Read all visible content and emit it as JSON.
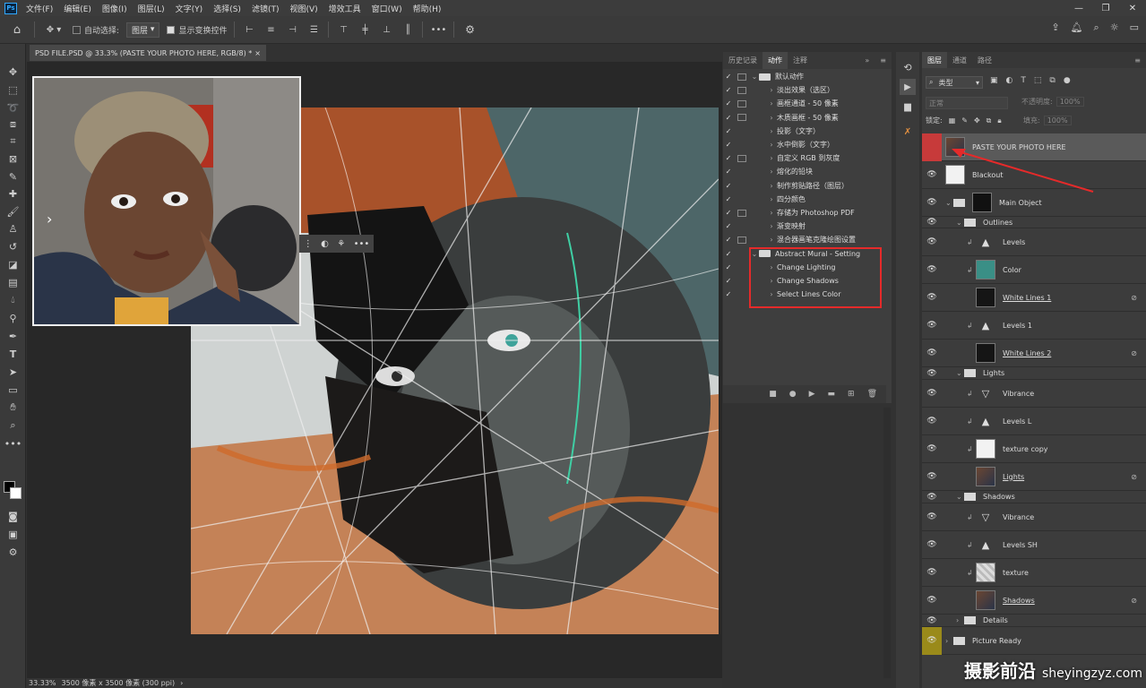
{
  "menu": {
    "logo": "Ps",
    "items": [
      "文件(F)",
      "编辑(E)",
      "图像(I)",
      "图层(L)",
      "文字(Y)",
      "选择(S)",
      "滤镜(T)",
      "视图(V)",
      "增效工具",
      "窗口(W)",
      "帮助(H)"
    ]
  },
  "options": {
    "auto_select_label": "自动选择:",
    "auto_select_value": "图层",
    "show_transform_label": "显示变换控件"
  },
  "document": {
    "tab_title": "PSD FILE.PSD @ 33.3% (PASTE YOUR PHOTO HERE, RGB/8) *",
    "zoom": "33.33%",
    "size_info": "3500 像素 x 3500 像素 (300 ppi)"
  },
  "actions_panel": {
    "tabs": [
      "历史记录",
      "动作",
      "注释"
    ],
    "active_tab": "动作",
    "rows": [
      {
        "label": "默认动作",
        "type": "set",
        "expanded": true,
        "dialog": true
      },
      {
        "label": "淡出效果（选区）",
        "dialog": true
      },
      {
        "label": "画框通道 - 50 像素",
        "dialog": true
      },
      {
        "label": "木质画框 - 50 像素",
        "dialog": true
      },
      {
        "label": "投影（文字）",
        "dialog": false
      },
      {
        "label": "水中倒影（文字）",
        "dialog": false
      },
      {
        "label": "自定义 RGB 到灰度",
        "dialog": true
      },
      {
        "label": "熔化的铅块",
        "dialog": false
      },
      {
        "label": "制作剪贴路径（图层）",
        "dialog": false
      },
      {
        "label": "四分颜色",
        "dialog": false
      },
      {
        "label": "存储为 Photoshop PDF",
        "dialog": true
      },
      {
        "label": "渐变映射",
        "dialog": false
      },
      {
        "label": "混合器画笔克隆绘图设置",
        "dialog": true
      },
      {
        "label": "Abstract Mural - Setting",
        "type": "set",
        "expanded": true,
        "dialog": false
      },
      {
        "label": "Change Lighting",
        "dialog": false
      },
      {
        "label": "Change Shadows",
        "dialog": false
      },
      {
        "label": "Select Lines Color",
        "dialog": false
      }
    ]
  },
  "layers_panel": {
    "tabs": [
      "图层",
      "通道",
      "路径"
    ],
    "active_tab": "图层",
    "filter_kind": "类型",
    "blend_mode": "正常",
    "opacity_label": "不透明度:",
    "opacity_value": "100%",
    "lock_label": "锁定:",
    "fill_label": "填充:",
    "fill_value": "100%",
    "layers": [
      {
        "name": "PASTE YOUR PHOTO HERE",
        "kind": "photo",
        "indent": 0,
        "selected": true
      },
      {
        "name": "Blackout",
        "kind": "white",
        "indent": 0
      },
      {
        "name": "Main Object",
        "kind": "group-mask",
        "indent": 0
      },
      {
        "name": "Outlines",
        "kind": "group",
        "indent": 1
      },
      {
        "name": "Levels",
        "kind": "levels",
        "indent": 2
      },
      {
        "name": "Color",
        "kind": "teal",
        "indent": 2
      },
      {
        "name": "White Lines 1",
        "kind": "dark",
        "indent": 2,
        "link": true
      },
      {
        "name": "Levels 1",
        "kind": "levels",
        "indent": 2
      },
      {
        "name": "White Lines 2",
        "kind": "dark",
        "indent": 2,
        "link": true
      },
      {
        "name": "Lights",
        "kind": "group",
        "indent": 1
      },
      {
        "name": "Vibrance",
        "kind": "vibrance",
        "indent": 2
      },
      {
        "name": "Levels L",
        "kind": "levels",
        "indent": 2
      },
      {
        "name": "texture copy",
        "kind": "white",
        "indent": 2
      },
      {
        "name": "Lights",
        "kind": "photo",
        "indent": 2,
        "link": true
      },
      {
        "name": "Shadows",
        "kind": "group",
        "indent": 1
      },
      {
        "name": "Vibrance",
        "kind": "vibrance",
        "indent": 2
      },
      {
        "name": "Levels SH",
        "kind": "levels",
        "indent": 2
      },
      {
        "name": "texture",
        "kind": "texture",
        "indent": 2
      },
      {
        "name": "Shadows",
        "kind": "photo",
        "indent": 2,
        "link": true
      },
      {
        "name": "Details",
        "kind": "group",
        "indent": 1
      },
      {
        "name": "Picture Ready",
        "kind": "group",
        "indent": 0
      }
    ]
  },
  "watermark": {
    "text": "摄影前沿",
    "url": "sheyingzyz.com"
  }
}
